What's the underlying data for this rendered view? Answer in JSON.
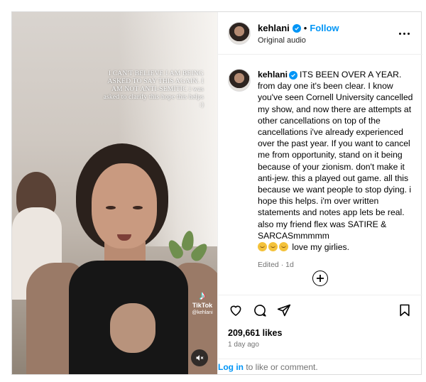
{
  "post": {
    "username": "kehlani",
    "follow_label": "Follow",
    "separator": "•",
    "audio_label": "Original audio",
    "caption": {
      "username": "kehlani",
      "text": "ITS BEEN OVER A YEAR. from day one it's been clear. I know you've seen Cornell University cancelled my show, and now there are attempts at other cancellations on top of the cancellations i've already experienced over the past year. If you want to cancel me from opportunity, stand on it being because of your zionism. don't make it anti-jew. this a played out game. all this because we want people to stop dying. i hope this helps. i'm over written statements and notes app lets be real. also my friend flex was SATIRE & SARCASmmmmm",
      "emoji_tail": "love my girlies.",
      "edited": "Edited · 1d"
    },
    "likes": "209,661 likes",
    "timestamp": "1 day ago",
    "login_link": "Log in",
    "login_rest": " to like or comment."
  },
  "media": {
    "overlay_text_upper": "I CAN'T BELIEVE I AM BEING ASKED TO SAY THIS AGAIN. I AM NOT ANTI-SEMITIC",
    "overlay_text_lower": "i was asked to clarify this hope this helps :)",
    "tiktok_label": "TikTok",
    "tiktok_handle": "@kehlani"
  },
  "icons": [
    "verified-icon",
    "more-options-icon",
    "add-comment-icon",
    "heart-icon",
    "comment-icon",
    "share-icon",
    "bookmark-icon",
    "mute-icon",
    "tiktok-icon"
  ],
  "colors": {
    "accent": "#0095f6",
    "muted": "#737373",
    "border": "#dbdbdb"
  }
}
